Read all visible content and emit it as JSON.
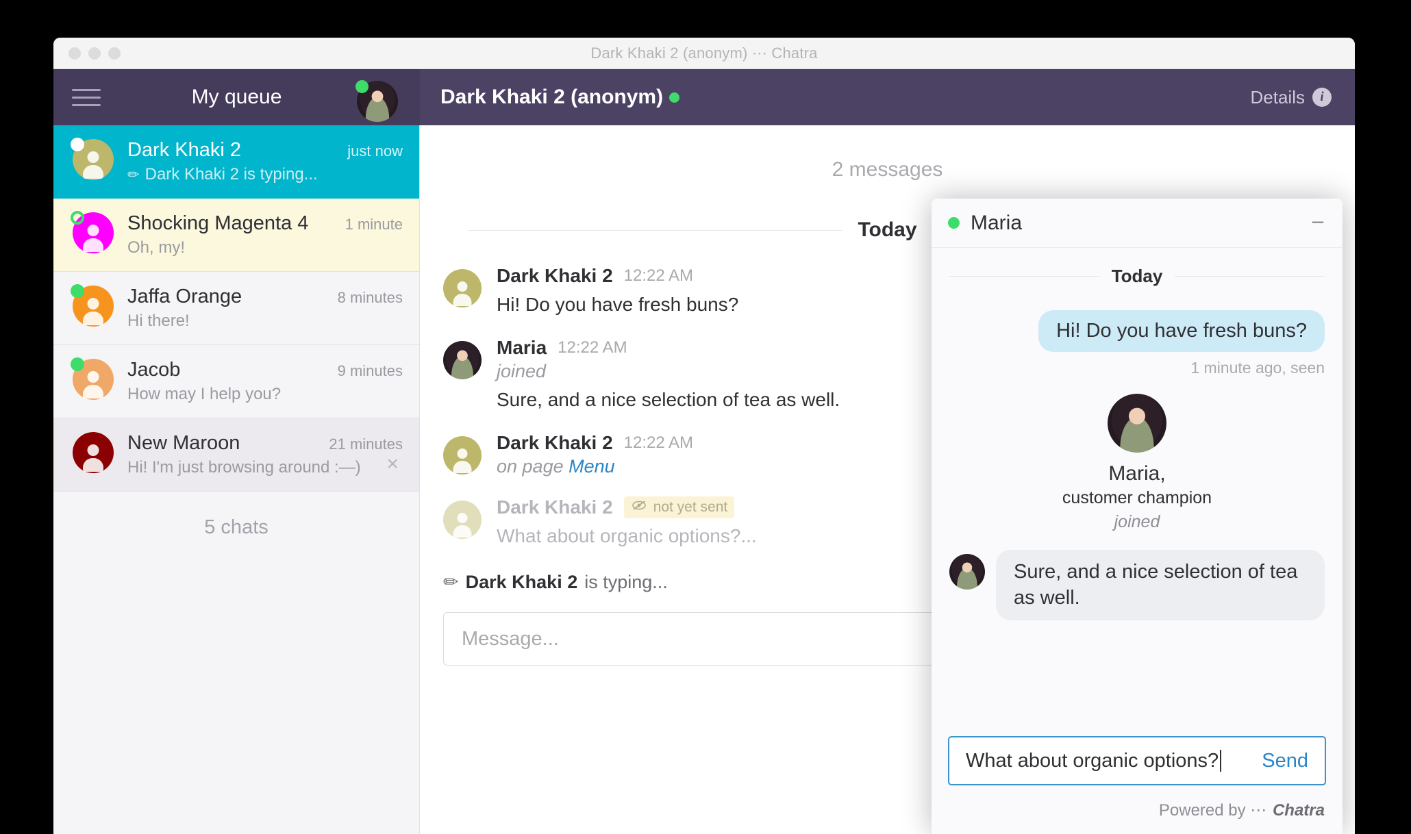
{
  "window": {
    "title": "Dark Khaki 2 (anonym) ⋯ Chatra"
  },
  "topnav": {
    "queue_title": "My queue",
    "conversation_title": "Dark Khaki 2 (anonym)",
    "details_label": "Details",
    "info_glyph": "i"
  },
  "sidebar": {
    "chats": [
      {
        "name": "Dark Khaki 2",
        "time": "just now",
        "snippet": "Dark Khaki 2 is typing...",
        "typing_icon": "✏",
        "state": "active",
        "badge": "white",
        "avatar_color": "#bdb76b"
      },
      {
        "name": "Shocking Magenta 4",
        "time": "1 minute",
        "snippet": "Oh, my!",
        "state": "unread",
        "badge": "ring",
        "avatar_color": "#ff00ff"
      },
      {
        "name": "Jaffa Orange",
        "time": "8 minutes",
        "snippet": "Hi there!",
        "state": "normal",
        "badge": "green",
        "avatar_color": "#f7941e"
      },
      {
        "name": "Jacob",
        "time": "9 minutes",
        "snippet": "How may I help you?",
        "state": "normal",
        "badge": "green",
        "avatar_color": "#f0a868"
      },
      {
        "name": "New Maroon",
        "time": "21 minutes",
        "snippet": "Hi! I'm just browsing around :—)",
        "state": "hovered",
        "badge": "none",
        "avatar_color": "#8b0000",
        "close_icon": "×"
      }
    ],
    "count_label": "5 chats"
  },
  "conversation": {
    "message_count": "2 messages",
    "day_label": "Today",
    "messages": [
      {
        "author": "Dark Khaki 2",
        "time": "12:22 AM",
        "text": "Hi! Do you have fresh buns?",
        "avatar_color": "#bdb76b",
        "avatar_type": "glyph"
      },
      {
        "author": "Maria",
        "time": "12:22 AM",
        "meta": "joined",
        "text": "Sure, and a nice selection of tea as well.",
        "avatar_type": "photo"
      },
      {
        "author": "Dark Khaki 2",
        "time": "12:22 AM",
        "meta_prefix": "on page ",
        "meta_link": "Menu",
        "avatar_color": "#bdb76b",
        "avatar_type": "glyph"
      },
      {
        "author": "Dark Khaki 2",
        "badge": "not yet sent",
        "badge_icon": "👁",
        "text": "What about organic options?...",
        "avatar_color": "#bdb76b",
        "avatar_type": "glyph",
        "pending": true
      }
    ],
    "typing_icon": "✏",
    "typing_author": "Dark Khaki 2",
    "typing_suffix": " is typing...",
    "composer_placeholder": "Message..."
  },
  "widget": {
    "agent_name": "Maria",
    "minimize_icon": "−",
    "day_label": "Today",
    "outgoing": {
      "text": "Hi! Do you have fresh buns?",
      "meta": "1 minute ago, seen"
    },
    "agent_intro": {
      "name": "Maria,",
      "role": "customer champion",
      "joined": "joined"
    },
    "incoming": {
      "text": "Sure, and a nice selection of tea as well."
    },
    "input_value": "What about organic options?",
    "send_label": "Send",
    "footer_prefix": "Powered by ",
    "footer_dots": "⋯",
    "footer_brand": "Chatra"
  },
  "colors": {
    "nav_left": "#453c5c",
    "nav_right": "#4b4264",
    "active_chat": "#00b5cc",
    "unread_chat": "#fbf8dd",
    "online": "#3ddc6b",
    "link": "#2a84c8"
  }
}
